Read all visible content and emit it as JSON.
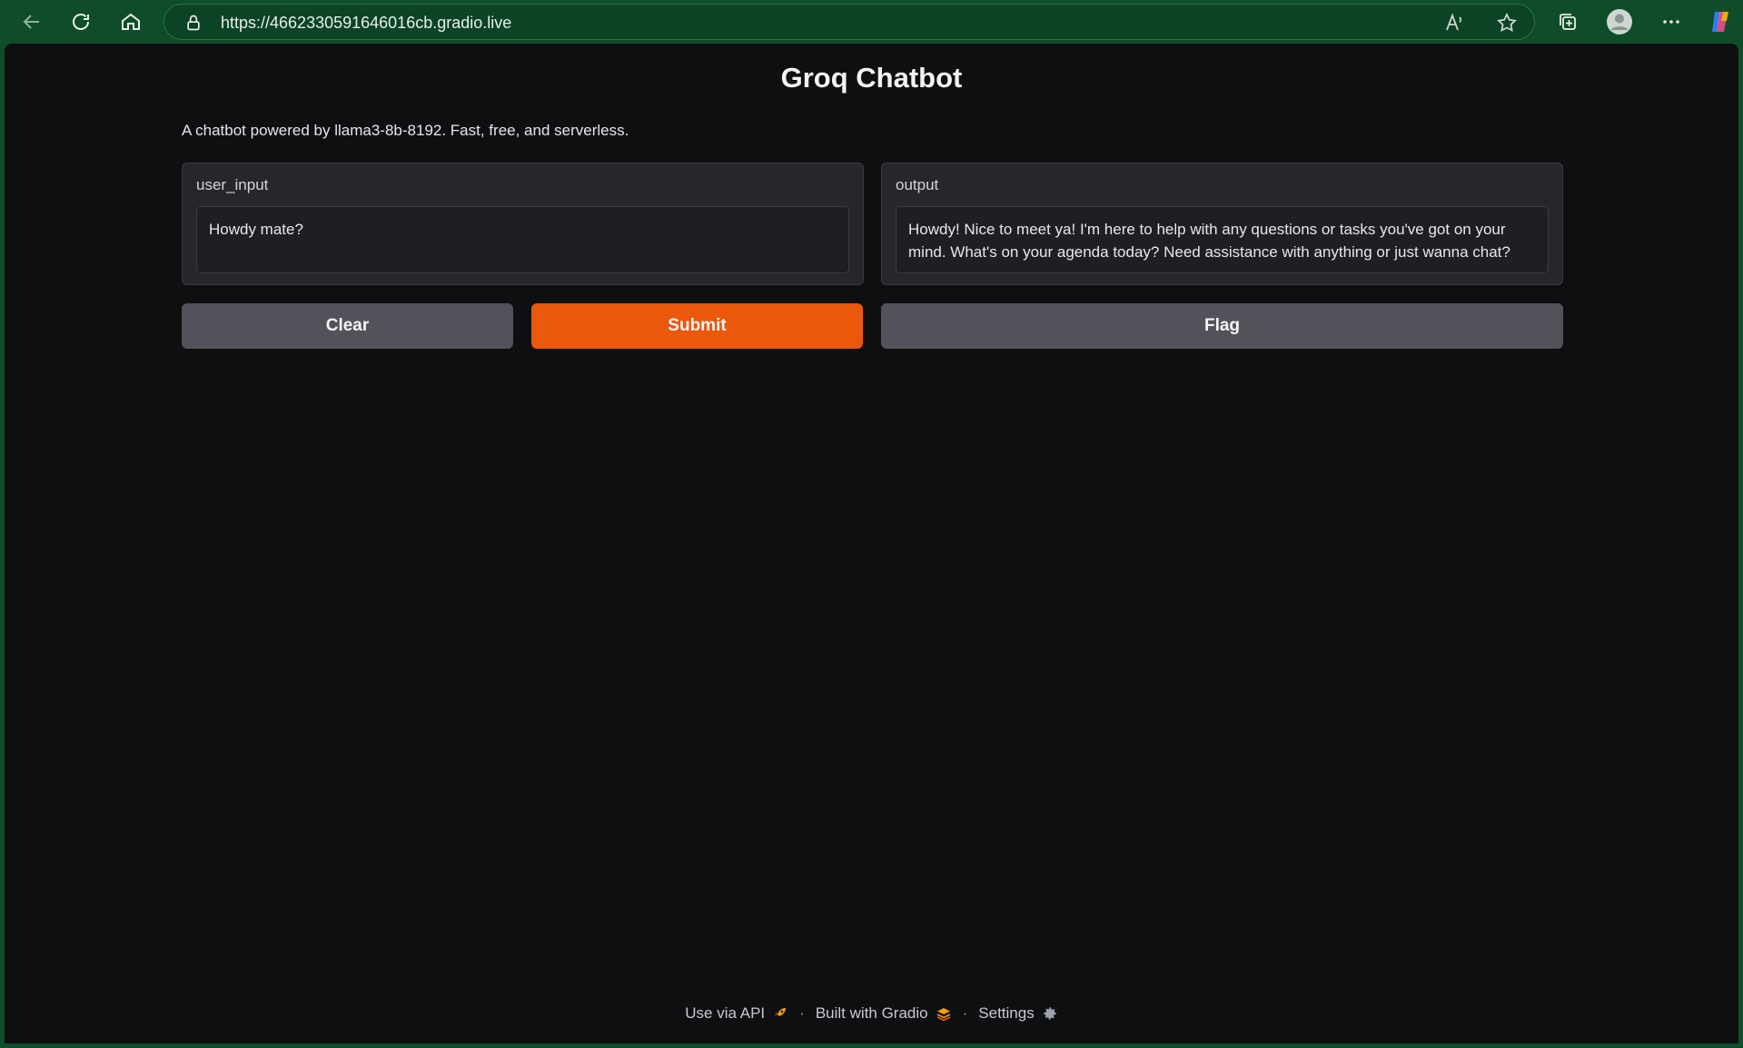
{
  "browser": {
    "url": "https://4662330591646016cb.gradio.live"
  },
  "page": {
    "title": "Groq Chatbot",
    "description": "A chatbot powered by llama3-8b-8192. Fast, free, and serverless."
  },
  "input_panel": {
    "label": "user_input",
    "value": "Howdy mate?"
  },
  "output_panel": {
    "label": "output",
    "value": "Howdy! Nice to meet ya! I'm here to help with any questions or tasks you've got on your mind. What's on your agenda today? Need assistance with anything or just wanna chat?"
  },
  "buttons": {
    "clear": "Clear",
    "submit": "Submit",
    "flag": "Flag"
  },
  "footer": {
    "api": "Use via API",
    "built": "Built with Gradio",
    "settings": "Settings",
    "separator": "·"
  },
  "colors": {
    "chrome": "#0f4d2a",
    "page_bg": "#0e0f11",
    "primary": "#ea580c",
    "secondary": "#52535a"
  }
}
